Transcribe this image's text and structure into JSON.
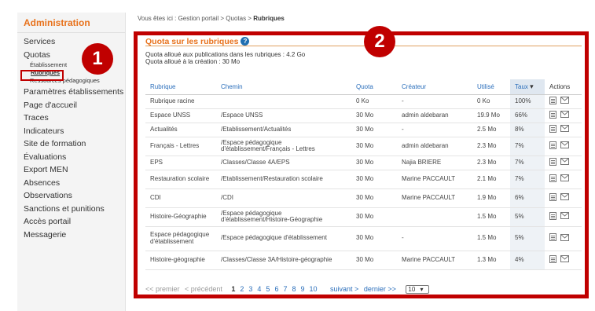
{
  "breadcrumb": {
    "prefix": "Vous êtes ici : Gestion portail > Quotas > ",
    "current": "Rubriques"
  },
  "sidebar": {
    "title": "Administration",
    "items_top": [
      "Services",
      "Quotas"
    ],
    "sub_items": [
      "Établissement",
      "Rubriques",
      "Ressources pédagogiques"
    ],
    "items_bottom": [
      "Paramètres établissements",
      "Page d'accueil",
      "Traces",
      "Indicateurs",
      "Site de formation",
      "Évaluations",
      "Export MEN",
      "Absences",
      "Observations",
      "Sanctions et punitions",
      "Accès portail",
      "Messagerie"
    ]
  },
  "badges": [
    "1",
    "2"
  ],
  "panel": {
    "title": "Quota sur les rubriques",
    "help_icon": "?",
    "quota_line1": "Quota alloué aux publications dans les rubriques : 4.2 Go",
    "quota_line2": "Quota alloué à la création : 30 Mo"
  },
  "table": {
    "headers": [
      "Rubrique",
      "Chemin",
      "Quota",
      "Créateur",
      "Utilisé",
      "Taux",
      "Actions"
    ],
    "sort_icon": "▾",
    "rows": [
      {
        "rubrique": "Rubrique racine",
        "chemin": "",
        "quota": "0 Ko",
        "createur": "-",
        "utilise": "0 Ko",
        "taux": "100%"
      },
      {
        "rubrique": "Espace UNSS",
        "chemin": "/Espace UNSS",
        "quota": "30 Mo",
        "createur": "admin aldebaran",
        "utilise": "19.9 Mo",
        "taux": "66%"
      },
      {
        "rubrique": "Actualités",
        "chemin": "/Etablissement/Actualités",
        "quota": "30 Mo",
        "createur": "-",
        "utilise": "2.5 Mo",
        "taux": "8%"
      },
      {
        "rubrique": "Français - Lettres",
        "chemin": "/Espace pédagogique d'établissement/Français - Lettres",
        "quota": "30 Mo",
        "createur": "admin aldebaran",
        "utilise": "2.3 Mo",
        "taux": "7%"
      },
      {
        "rubrique": "EPS",
        "chemin": "/Classes/Classe 4A/EPS",
        "quota": "30 Mo",
        "createur": "Najia BRIERE",
        "utilise": "2.3 Mo",
        "taux": "7%"
      },
      {
        "rubrique": "Restauration scolaire",
        "chemin": "/Etablissement/Restauration scolaire",
        "quota": "30 Mo",
        "createur": "Marine PACCAULT",
        "utilise": "2.1 Mo",
        "taux": "7%"
      },
      {
        "rubrique": "CDI",
        "chemin": "/CDI",
        "quota": "30 Mo",
        "createur": "Marine PACCAULT",
        "utilise": "1.9 Mo",
        "taux": "6%"
      },
      {
        "rubrique": "Histoire-Géographie",
        "chemin": "/Espace pédagogique d'établissement/Histoire-Géographie",
        "quota": "30 Mo",
        "createur": "",
        "utilise": "1.5 Mo",
        "taux": "5%"
      },
      {
        "rubrique": "Espace pédagogique d'établissement",
        "chemin": "/Espace pédagogique d'établissement",
        "quota": "30 Mo",
        "createur": "-",
        "utilise": "1.5 Mo",
        "taux": "5%"
      },
      {
        "rubrique": "Histoire-géographie",
        "chemin": "/Classes/Classe 3A/Histoire-géographie",
        "quota": "30 Mo",
        "createur": "Marine PACCAULT",
        "utilise": "1.3 Mo",
        "taux": "4%"
      }
    ],
    "action_icons": [
      "document-icon",
      "envelope-icon"
    ]
  },
  "pager": {
    "first": "<< premier",
    "prev": "< précédent",
    "pages": [
      "1",
      "2",
      "3",
      "4",
      "5",
      "6",
      "7",
      "8",
      "9",
      "10"
    ],
    "current_page": "1",
    "next": "suivant >",
    "last": "dernier >>",
    "page_size": "10"
  },
  "colors": {
    "accent": "#e8721c",
    "link": "#2a6ebb",
    "highlight": "#c00000"
  }
}
